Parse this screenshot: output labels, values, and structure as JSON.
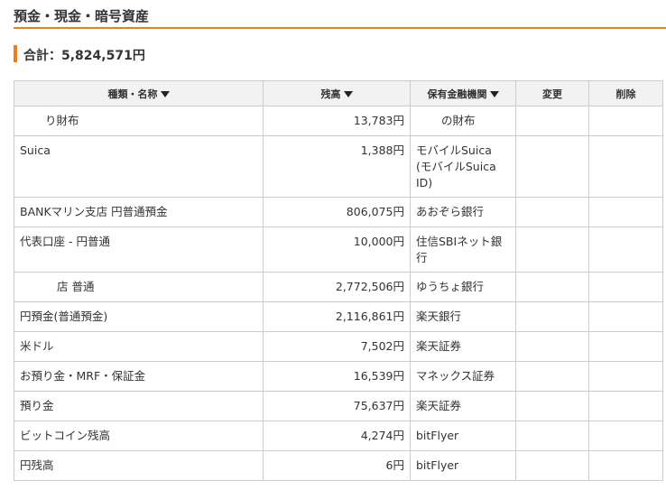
{
  "page": {
    "title": "預金・現金・暗号資産",
    "total": "合計：5,824,571円"
  },
  "table": {
    "headers": [
      "種類・名称",
      "残高",
      "保有金融機関",
      "変更",
      "削除"
    ],
    "sortable": [
      true,
      true,
      true,
      false,
      false
    ],
    "rows": [
      {
        "name": "り財布",
        "balance": "13,783円",
        "institution": "の財布",
        "edit": "",
        "delete": ""
      },
      {
        "name": "Suica",
        "balance": "1,388円",
        "institution": "モバイルSuica (モバイルSuica ID)",
        "edit": "",
        "delete": ""
      },
      {
        "name": "BANKマリン支店 円普通預金",
        "balance": "806,075円",
        "institution": "あおぞら銀行",
        "edit": "",
        "delete": ""
      },
      {
        "name": "代表口座 - 円普通",
        "balance": "10,000円",
        "institution": "住信SBIネット銀行",
        "edit": "",
        "delete": ""
      },
      {
        "name": "店 普通",
        "balance": "2,772,506円",
        "institution": "ゆうちょ銀行",
        "edit": "",
        "delete": ""
      },
      {
        "name": "円預金(普通預金)",
        "balance": "2,116,861円",
        "institution": "楽天銀行",
        "edit": "",
        "delete": ""
      },
      {
        "name": "米ドル",
        "balance": "7,502円",
        "institution": "楽天証券",
        "edit": "",
        "delete": ""
      },
      {
        "name": "お預り金・MRF・保証金",
        "balance": "16,539円",
        "institution": "マネックス証券",
        "edit": "",
        "delete": ""
      },
      {
        "name": "預り金",
        "balance": "75,637円",
        "institution": "楽天証券",
        "edit": "",
        "delete": ""
      },
      {
        "name": "ビットコイン残高",
        "balance": "4,274円",
        "institution": "bitFlyer",
        "edit": "",
        "delete": ""
      },
      {
        "name": "円残高",
        "balance": "6円",
        "institution": "bitFlyer",
        "edit": "",
        "delete": ""
      }
    ]
  },
  "colors": {
    "accent": "#ed7d1f",
    "header_bg": "#f2f2f2",
    "border": "#cccccc"
  }
}
